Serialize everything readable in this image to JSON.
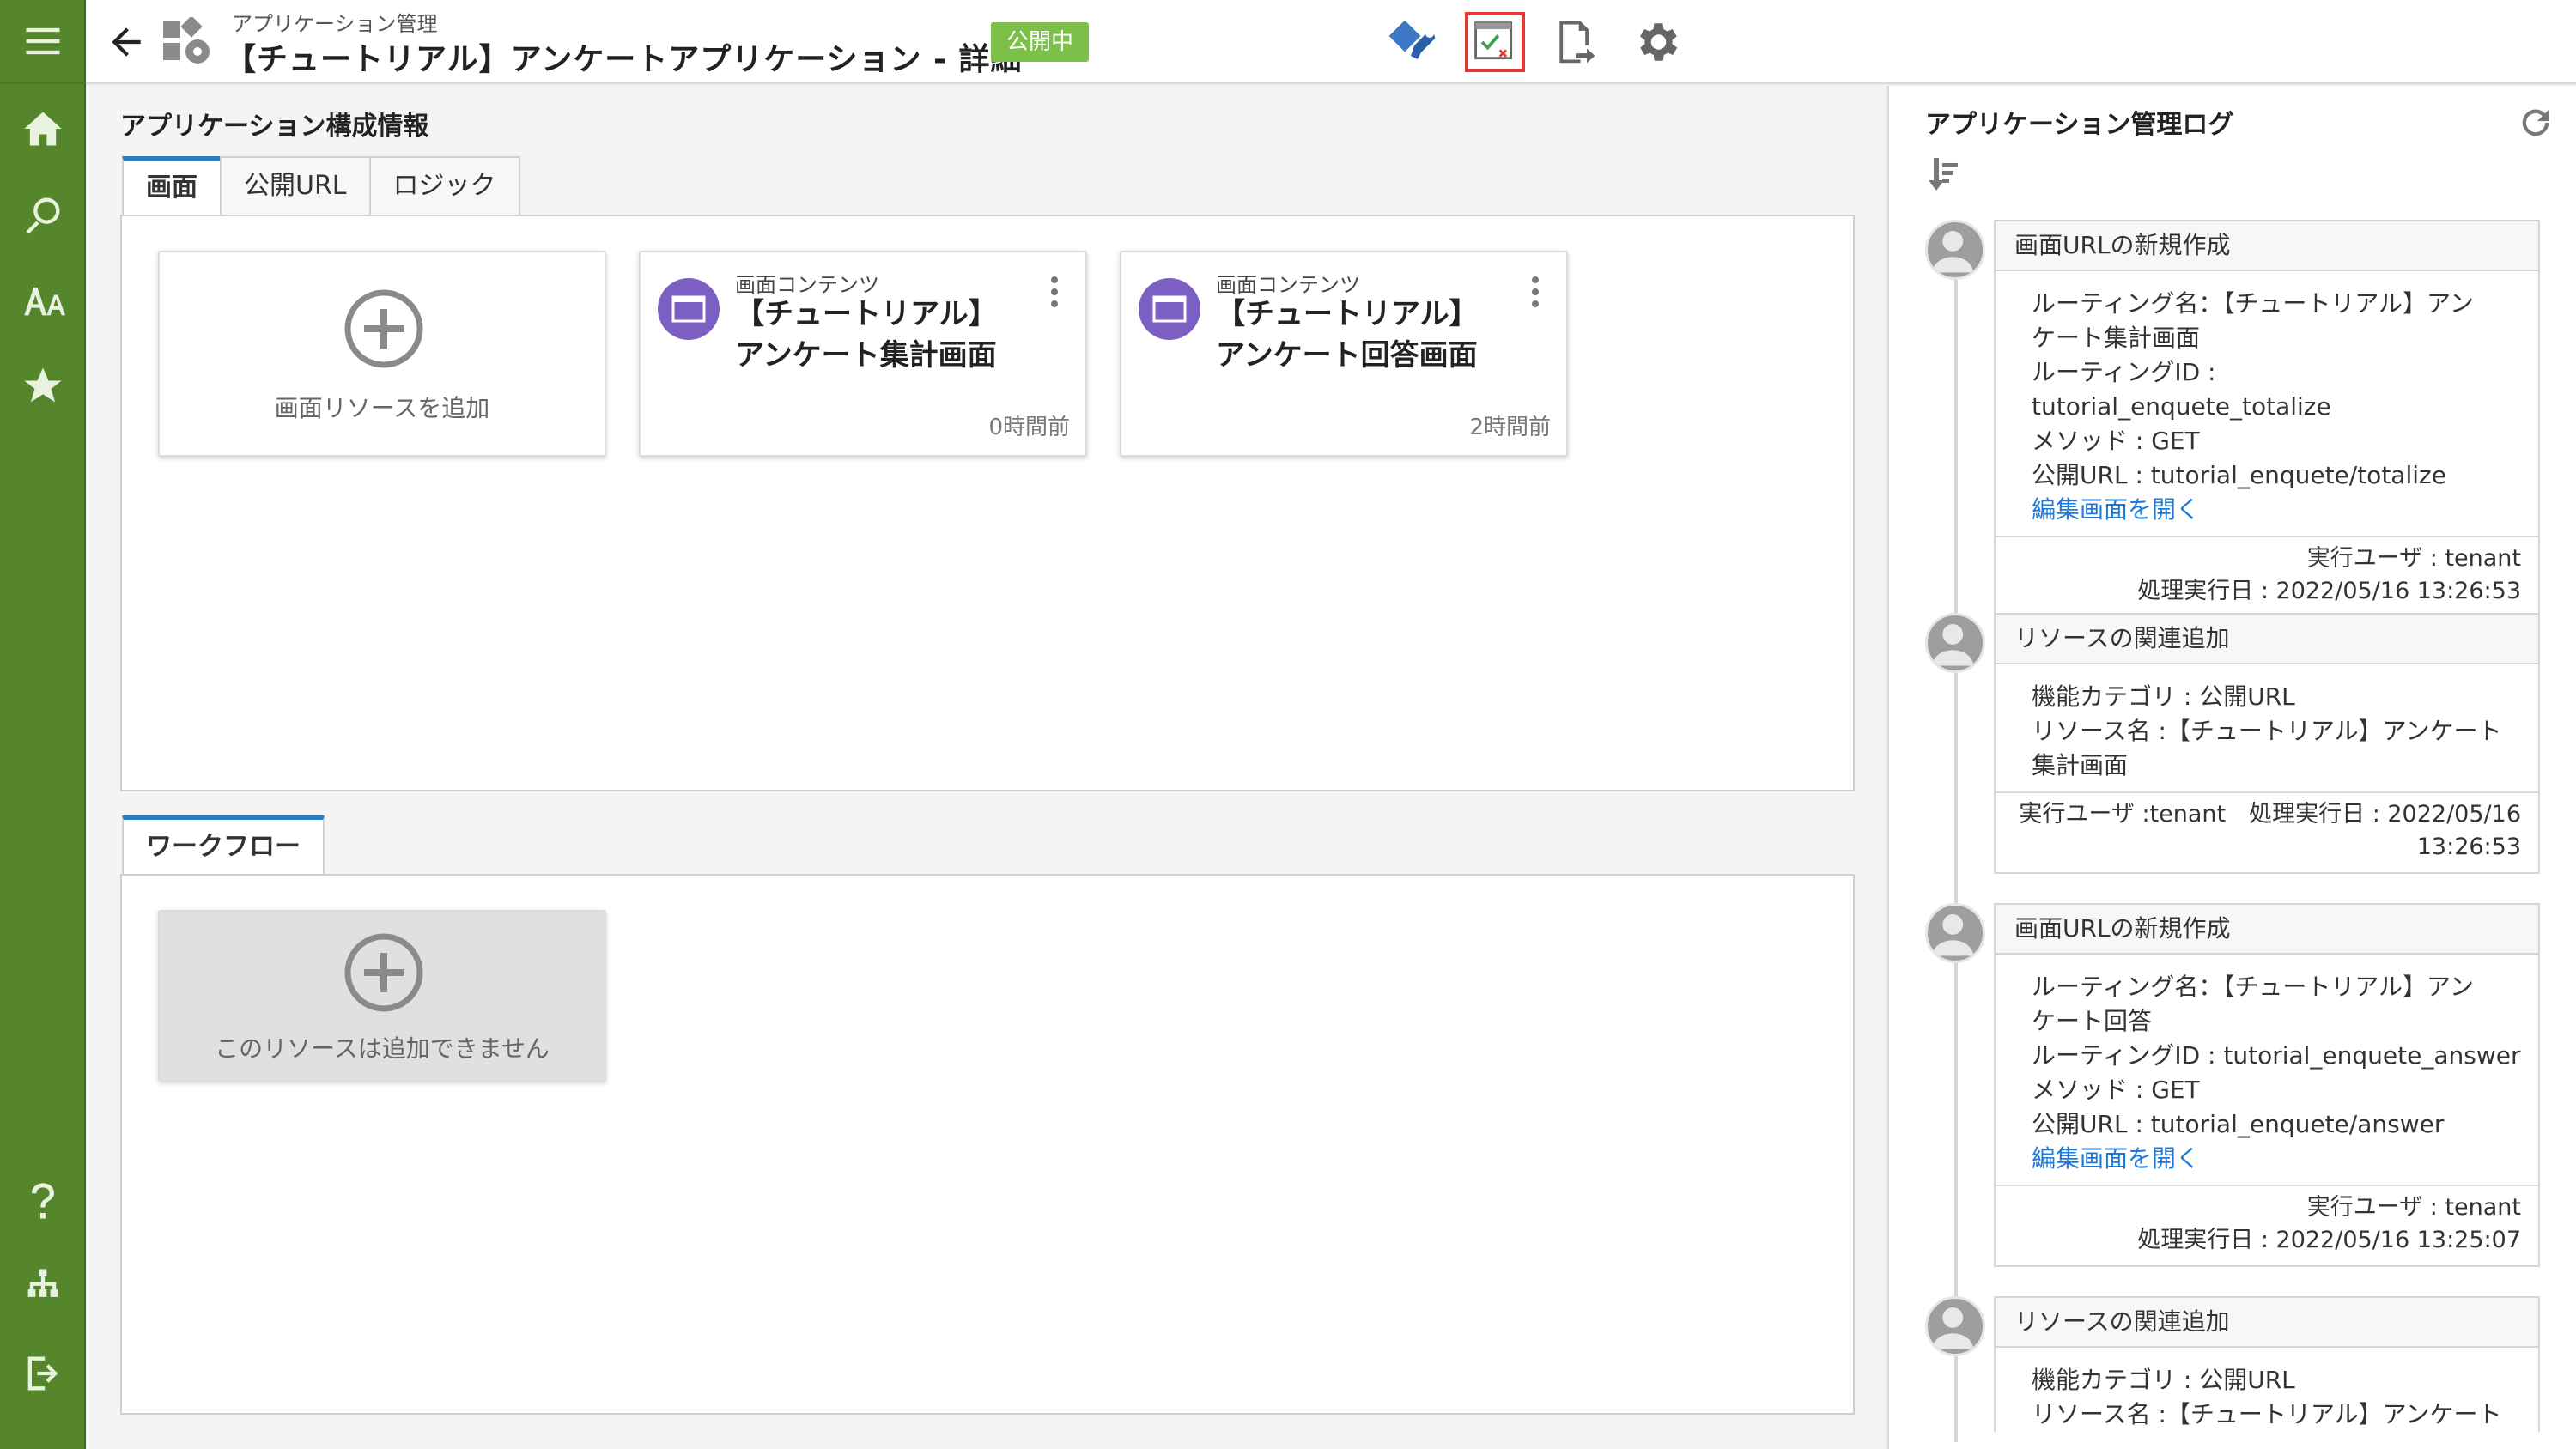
{
  "header": {
    "breadcrumb": "アプリケーション管理",
    "title": "【チュートリアル】アンケートアプリケーション - 詳細",
    "status_badge": "公開中"
  },
  "config_section": {
    "title": "アプリケーション構成情報",
    "tabs": [
      {
        "label": "画面",
        "active": true
      },
      {
        "label": "公開URL",
        "active": false
      },
      {
        "label": "ロジック",
        "active": false
      }
    ],
    "add_card_label": "画面リソースを追加",
    "resources": [
      {
        "type": "画面コンテンツ",
        "name_line1": "【チュートリアル】",
        "name_line2": "アンケート集計画面",
        "time": "0時間前"
      },
      {
        "type": "画面コンテンツ",
        "name_line1": "【チュートリアル】",
        "name_line2": "アンケート回答画面",
        "time": "2時間前"
      }
    ]
  },
  "workflow_section": {
    "tab_label": "ワークフロー",
    "disabled_card_label": "このリソースは追加できません"
  },
  "log": {
    "title": "アプリケーション管理ログ",
    "entries": [
      {
        "title": "画面URLの新規作成",
        "lines": [
          "ルーティング名：【チュートリアル】アン",
          "ケート集計画面",
          "ルーティングID : tutorial_enquete_totalize",
          "メソッド : GET",
          "公開URL : tutorial_enquete/totalize"
        ],
        "link": "編集画面を開く",
        "foot1": "実行ユーザ : tenant",
        "foot2": "処理実行日 : 2022/05/16 13:26:53"
      },
      {
        "title": "リソースの関連追加",
        "lines": [
          "機能カテゴリ : 公開URL",
          "リソース名 :【チュートリアル】アンケート",
          "集計画面"
        ],
        "foot1": "実行ユーザ :tenant　処理実行日 : 2022/05/16",
        "foot2": "13:26:53"
      },
      {
        "title": "画面URLの新規作成",
        "lines": [
          "ルーティング名：【チュートリアル】アン",
          "ケート回答",
          "ルーティングID : tutorial_enquete_answer",
          "メソッド : GET",
          "公開URL : tutorial_enquete/answer"
        ],
        "link": "編集画面を開く",
        "foot1": "実行ユーザ : tenant",
        "foot2": "処理実行日 : 2022/05/16 13:25:07"
      },
      {
        "title": "リソースの関連追加",
        "lines": [
          "機能カテゴリ : 公開URL",
          "リソース名 :【チュートリアル】アンケート"
        ]
      }
    ]
  },
  "colors": {
    "sidebar": "#56862c",
    "badge": "#7cc04a",
    "tab_accent": "#2a7cc7",
    "resource_icon": "#7b5fc2",
    "link": "#1e7ad6",
    "highlight": "#e53935"
  }
}
